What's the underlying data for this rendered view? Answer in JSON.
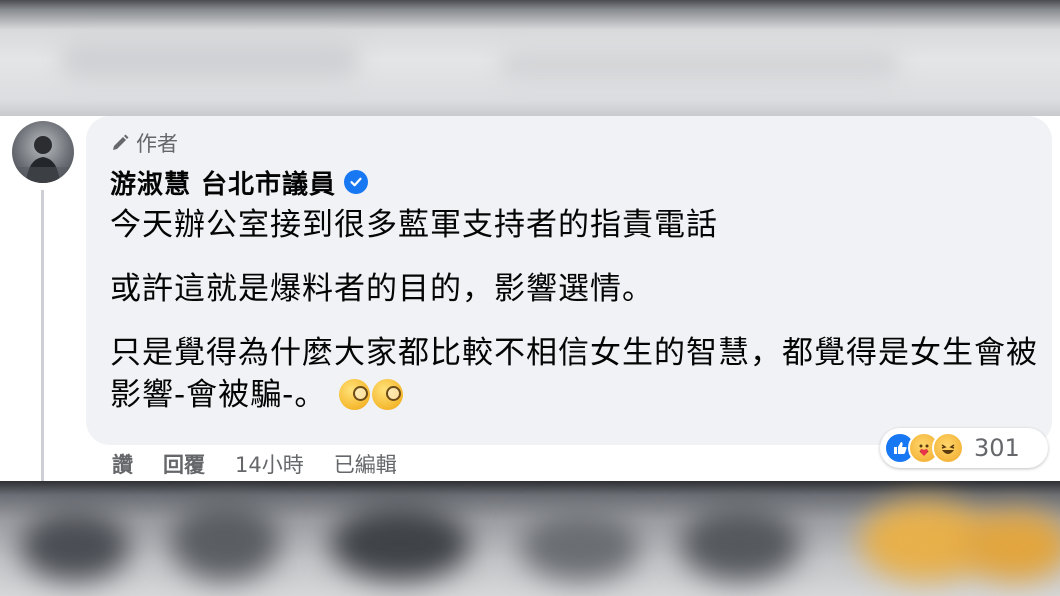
{
  "comment": {
    "author_badge": "作者",
    "author_name": "游淑慧 台北市議員",
    "paragraphs": [
      "今天辦公室接到很多藍軍支持者的指責電話",
      "或許這就是爆料者的目的，影響選情。",
      "只是覺得為什麼大家都比較不相信女生的智慧，都覺得是女生會被影響-會被騙-。"
    ],
    "emojis": [
      "monocle-face-emoji",
      "monocle-face-emoji"
    ],
    "reactions": {
      "types": [
        "like",
        "care",
        "haha"
      ],
      "count": "301"
    },
    "actions": {
      "like": "讚",
      "reply": "回覆",
      "time": "14小時",
      "edited": "已編輯"
    }
  },
  "colors": {
    "bubble": "#f0f2f5",
    "verified": "#1877f2",
    "like": "#1877f2",
    "secondary_text": "#65676b"
  }
}
